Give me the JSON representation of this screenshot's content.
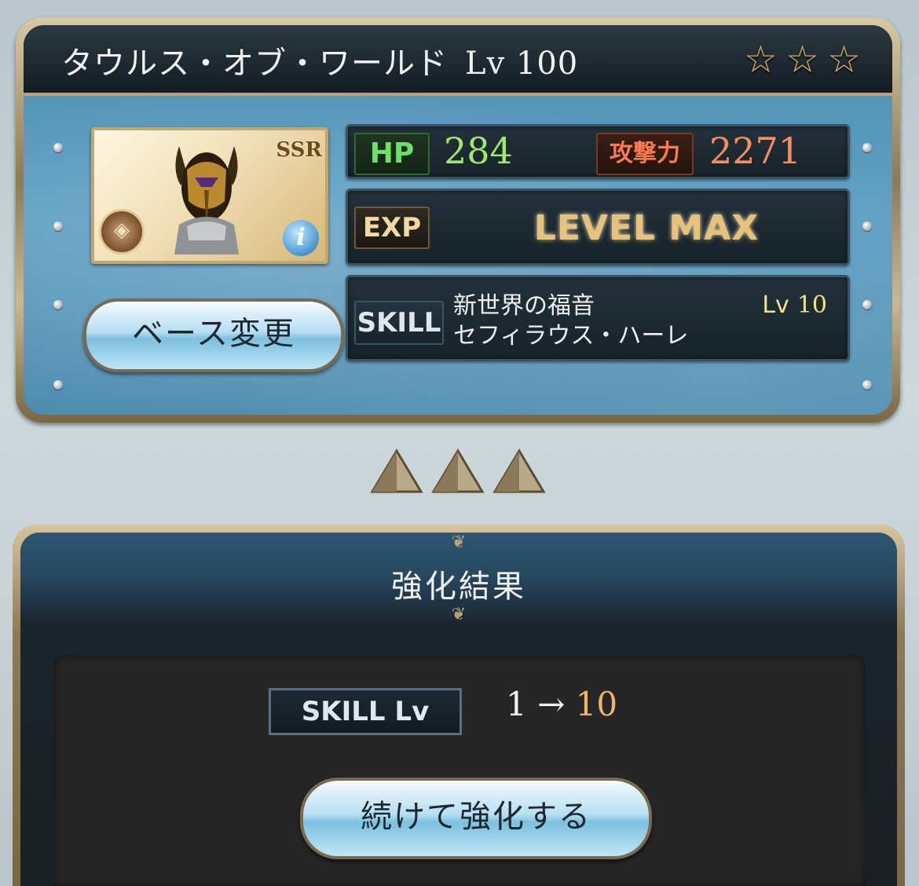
{
  "weapon": {
    "name": "タウルス・オブ・ワールド",
    "level_label": "Lv 100",
    "stars": [
      "☆",
      "☆",
      "☆"
    ],
    "rarity": "SSR",
    "element_icon": "earth-element-icon",
    "info_symbol": "i"
  },
  "stats": {
    "hp_label": "HP",
    "hp_value": "284",
    "atk_label": "攻撃力",
    "atk_value": "2271",
    "exp_label": "EXP",
    "exp_status": "LEVEL MAX"
  },
  "skill": {
    "label": "SKILL",
    "name_line1": "新世界の福音",
    "name_line2": "セフィラウス・ハーレ",
    "level_prefix": "Lv",
    "level_value": "10"
  },
  "buttons": {
    "base_change": "ベース変更",
    "continue": "続けて強化する"
  },
  "result": {
    "title": "強化結果",
    "skill_lv_label": "SKILL Lv",
    "from": "1",
    "arrow": "→",
    "to": "10"
  },
  "colors": {
    "panel_blue": "#5e9fc4",
    "gold_frame": "#b6a37d",
    "hp_green": "#9fe86b",
    "atk_orange": "#ff8e5a",
    "skill_lv_yellow": "#f6e27e",
    "result_to_orange": "#f0b46b"
  }
}
